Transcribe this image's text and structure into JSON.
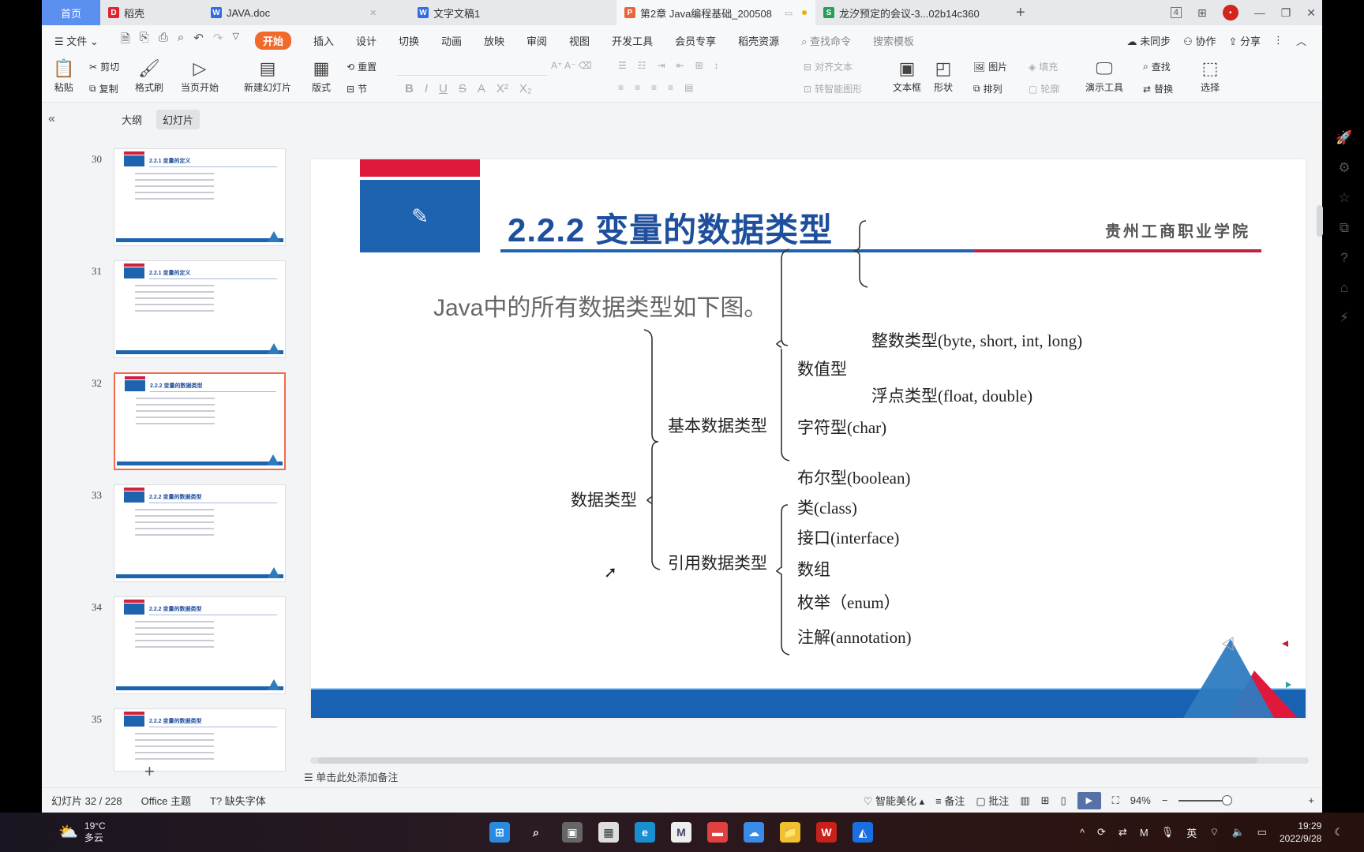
{
  "tabs": [
    {
      "label": "首页",
      "type": "home"
    },
    {
      "label": "稻壳",
      "icon": "daoke-icon",
      "color": "#e0242f"
    },
    {
      "label": "JAVA.doc",
      "icon": "word-doc-icon",
      "color": "#2f6ee0"
    },
    {
      "label": "文字文稿1",
      "icon": "word-doc-icon",
      "color": "#2f6ee0"
    },
    {
      "label": "第2章 Java编程基础_200508",
      "icon": "ppt-icon",
      "color": "#e8663a",
      "active": true
    },
    {
      "label": "龙汐预定的会议-3...02b14c360",
      "icon": "sheet-icon",
      "color": "#22a05a"
    }
  ],
  "window_controls": {
    "badge": "4",
    "avatar": "•"
  },
  "menu": {
    "file": "文件",
    "items": [
      "开始",
      "插入",
      "设计",
      "切换",
      "动画",
      "放映",
      "审阅",
      "视图",
      "开发工具",
      "会员专享",
      "稻壳资源"
    ],
    "active": "开始",
    "search_command": "查找命令",
    "search_template": "搜索模板",
    "sync": "未同步",
    "collab": "协作",
    "share": "分享"
  },
  "ribbon": {
    "paste": "粘贴",
    "cut": "剪切",
    "copy": "复制",
    "format_painter": "格式刷",
    "start_from_current": "当页开始",
    "new_slide": "新建幻灯片",
    "layout": "版式",
    "reset": "重置",
    "section": "节",
    "align_text": "对齐文本",
    "smart_art": "转智能图形",
    "textbox": "文本框",
    "shape": "形状",
    "picture": "图片",
    "fill": "填充",
    "arrange": "排列",
    "outline": "轮廓",
    "presentation_tools": "演示工具",
    "find": "查找",
    "replace": "替换",
    "select": "选择"
  },
  "left_panel": {
    "outline_tab": "大纲",
    "slides_tab": "幻灯片",
    "thumbnails": [
      {
        "num": "30",
        "title": "2.2.1 变量的定义"
      },
      {
        "num": "31",
        "title": "2.2.1 变量的定义"
      },
      {
        "num": "32",
        "title": "2.2.2 变量的数据类型",
        "selected": true
      },
      {
        "num": "33",
        "title": "2.2.2 变量的数据类型"
      },
      {
        "num": "34",
        "title": "2.2.2 变量的数据类型"
      },
      {
        "num": "35",
        "title": "2.2.2 变量的数据类型"
      }
    ]
  },
  "slide": {
    "title": "2.2.2 变量的数据类型",
    "school": "贵州工商职业学院",
    "intro": "Java中的所有数据类型如下图。",
    "tree": {
      "root": "数据类型",
      "primitive": "基本数据类型",
      "reference": "引用数据类型",
      "numeric": "数值型",
      "integer": "整数类型(byte, short, int, long)",
      "float": "浮点类型(float, double)",
      "char": "字符型(char)",
      "boolean": "布尔型(boolean)",
      "class": "类(class)",
      "interface": "接口(interface)",
      "array": "数组",
      "enum": "枚举（enum）",
      "annotation": "注解(annotation)"
    }
  },
  "notes_placeholder": "单击此处添加备注",
  "status": {
    "slide_count": "幻灯片 32 / 228",
    "theme": "Office 主题",
    "missing_font": "缺失字体",
    "beautify": "智能美化",
    "notes": "备注",
    "comments": "批注",
    "zoom": "94%"
  },
  "taskbar": {
    "temp": "19°C",
    "weather": "多云",
    "ime": "英",
    "time": "19:29",
    "date": "2022/9/28"
  }
}
